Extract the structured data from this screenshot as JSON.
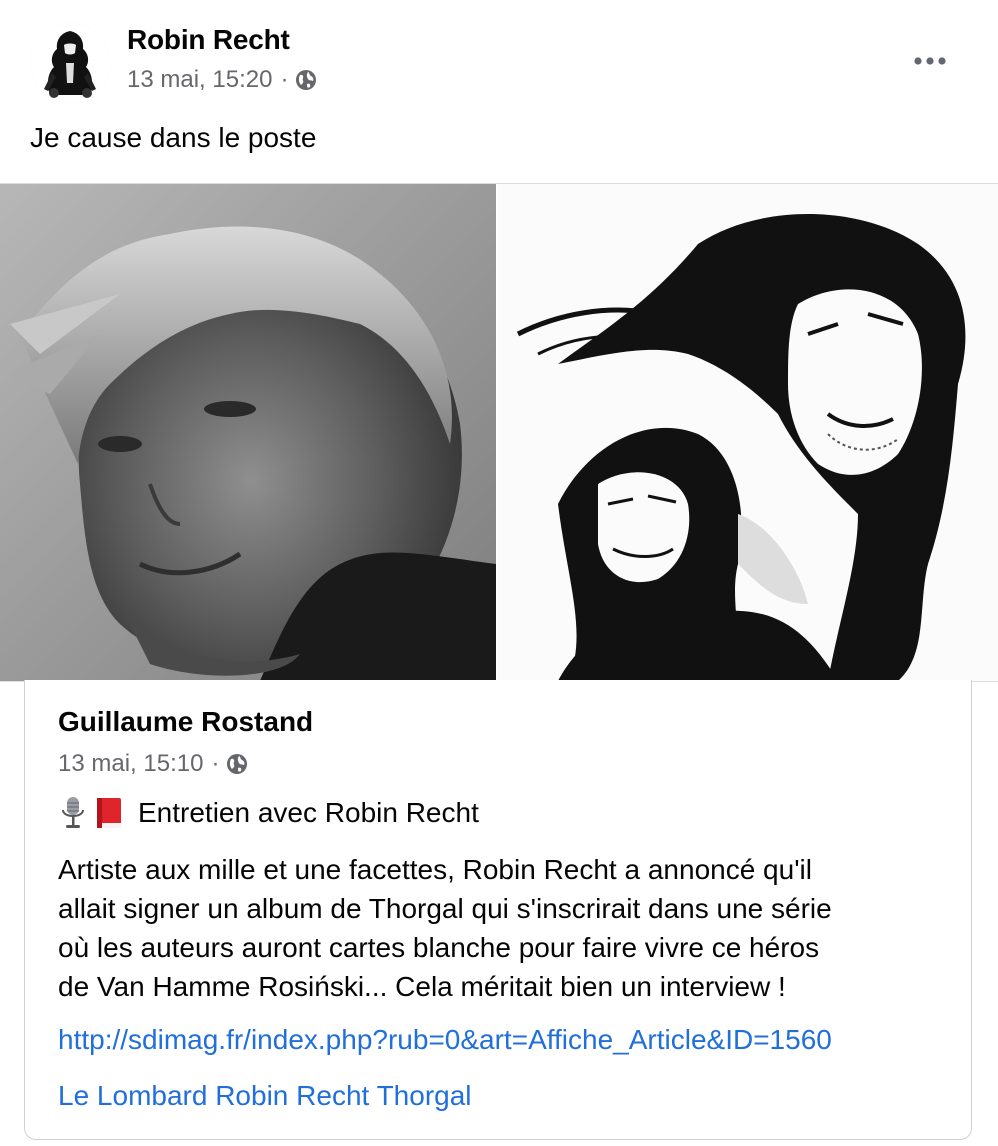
{
  "post": {
    "author": "Robin Recht",
    "timestamp": "13 mai, 15:20",
    "separator": "·",
    "privacy_icon": "globe-icon",
    "more_icon": "more-options-icon",
    "text": "Je cause dans le poste"
  },
  "photos": [
    {
      "name": "portrait-photo"
    },
    {
      "name": "illustration-photo"
    }
  ],
  "shared_post": {
    "author": "Guillaume Rostand",
    "timestamp": "13 mai, 15:10",
    "separator": "·",
    "privacy_icon": "globe-icon",
    "headline_icons": [
      "microphone-icon",
      "red-book-icon"
    ],
    "headline": "Entretien avec Robin Recht",
    "body_lines": [
      "Artiste aux mille et une facettes, Robin Recht a annoncé qu'il",
      "allait signer un album de Thorgal qui s'inscrirait dans une série",
      "où les auteurs auront cartes blanche pour faire vivre ce héros",
      "de Van Hamme Rosiński... Cela méritait bien un interview !"
    ],
    "link": "http://sdimag.fr/index.php?rub=0&art=Affiche_Article&ID=1560",
    "hashtags": "Le Lombard Robin Recht Thorgal"
  },
  "colors": {
    "text": "#050505",
    "secondary": "#65676b",
    "link": "#216fdb",
    "border": "#ced0d4"
  }
}
